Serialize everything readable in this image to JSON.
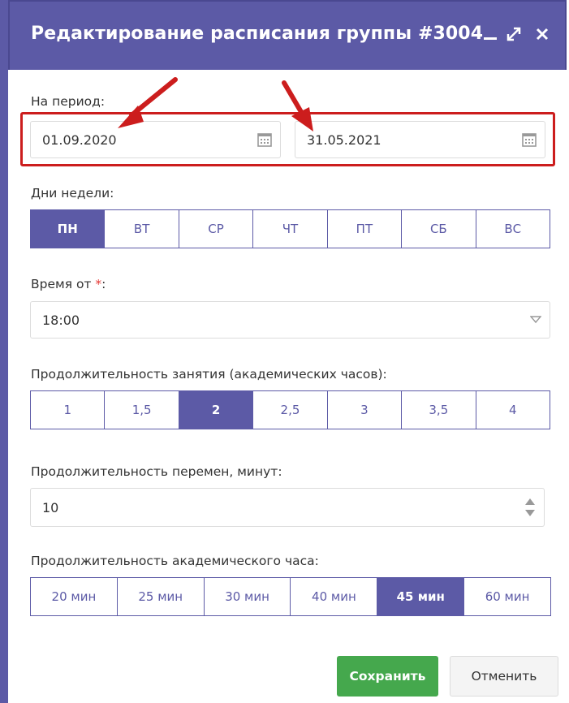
{
  "dialog": {
    "title": "Редактирование расписания группы #3004"
  },
  "period": {
    "label": "На период:",
    "from_value": "01.09.2020",
    "to_value": "31.05.2021"
  },
  "weekdays": {
    "label": "Дни недели:",
    "items": [
      "ПН",
      "ВТ",
      "СР",
      "ЧТ",
      "ПТ",
      "СБ",
      "ВС"
    ],
    "active": "ПН"
  },
  "time_from": {
    "label": "Время от ",
    "required_mark": "*",
    "label_suffix": ":",
    "value": "18:00"
  },
  "duration": {
    "label": "Продолжительность занятия (академических часов):",
    "items": [
      "1",
      "1,5",
      "2",
      "2,5",
      "3",
      "3,5",
      "4"
    ],
    "active": "2"
  },
  "breaks": {
    "label": "Продолжительность перемен, минут:",
    "value": "10"
  },
  "academic_hour": {
    "label": "Продолжительность академического часа:",
    "items": [
      "20 мин",
      "25 мин",
      "30 мин",
      "40 мин",
      "45 мин",
      "60 мин"
    ],
    "active": "45 мин"
  },
  "footer": {
    "save_label": "Сохранить",
    "cancel_label": "Отменить"
  },
  "colors": {
    "accent": "#5c5aa6",
    "annotation": "#cc1d1d",
    "save": "#45a84d"
  }
}
